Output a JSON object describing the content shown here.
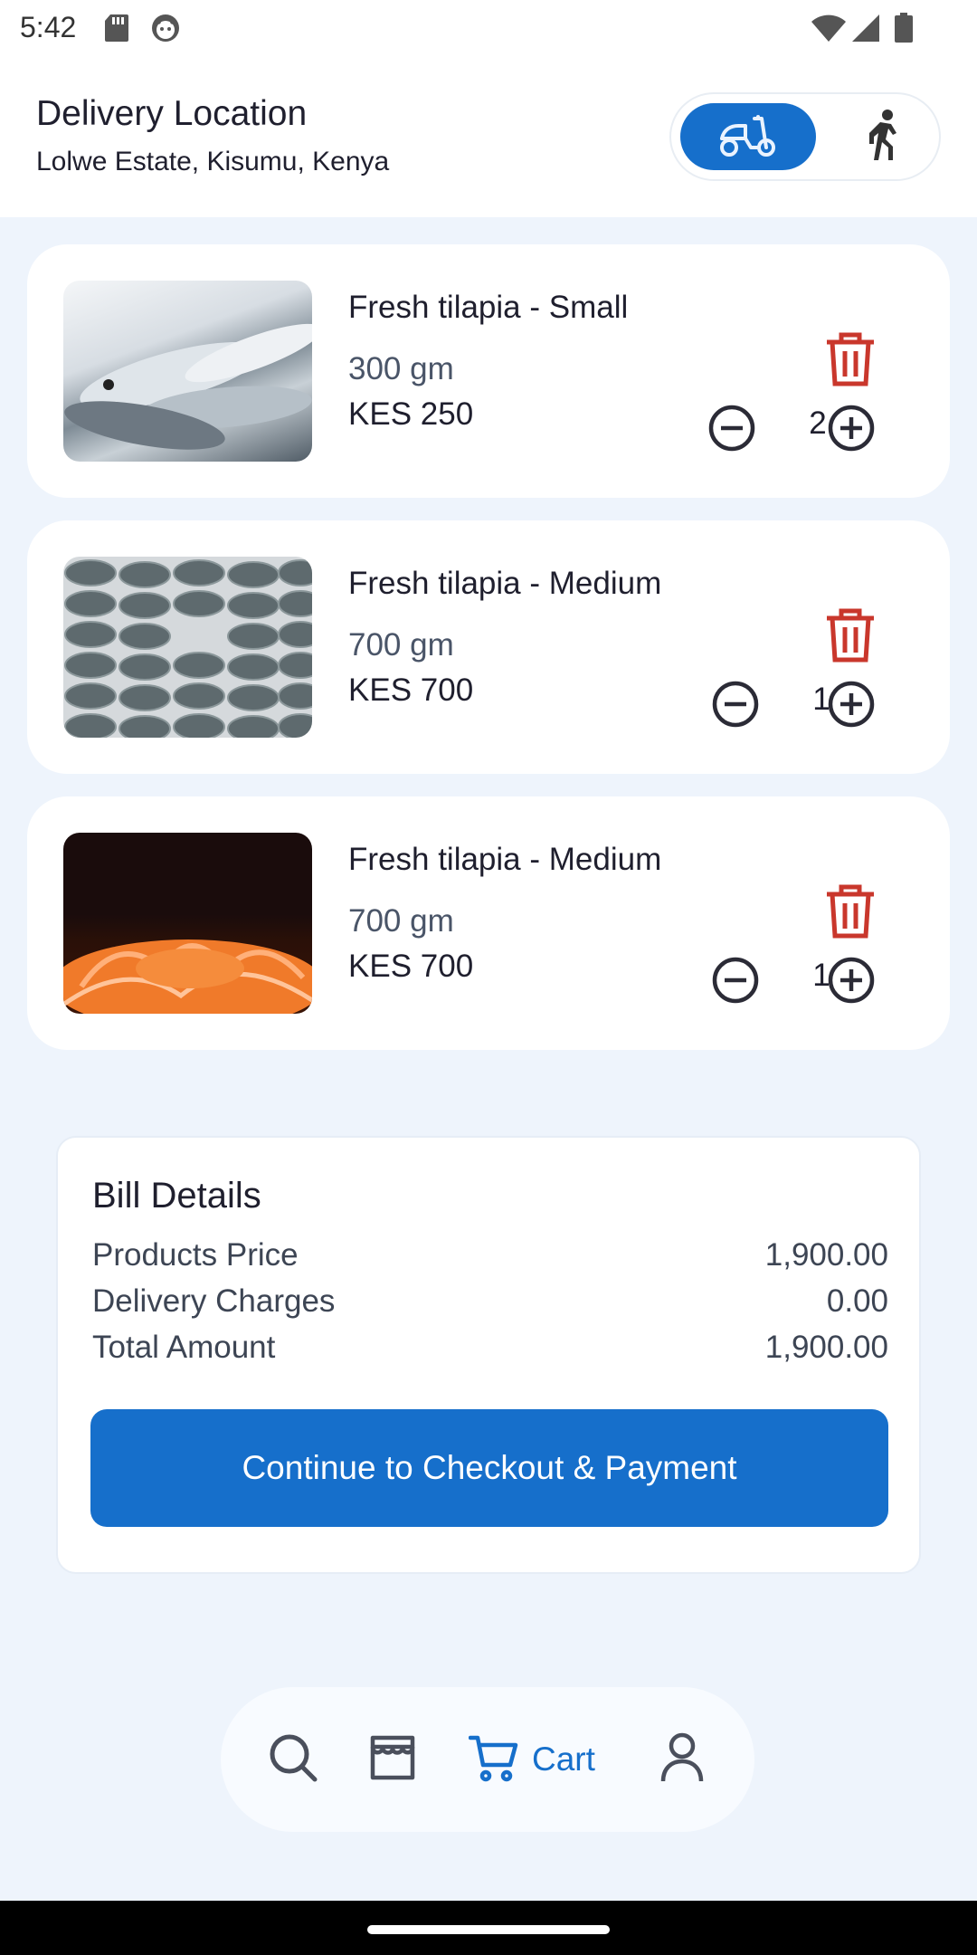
{
  "status": {
    "time": "5:42"
  },
  "header": {
    "title": "Delivery Location",
    "address": "Lolwe Estate, Kisumu, Kenya",
    "modes": [
      "scooter-icon",
      "walking-icon"
    ],
    "selected_mode": "scooter-icon"
  },
  "cart": {
    "items": [
      {
        "name": "Fresh tilapia - Small",
        "weight": "300 gm",
        "price": "KES 250",
        "qty": "2",
        "image": "fish-on-ice-photo"
      },
      {
        "name": "Fresh tilapia - Medium",
        "weight": "700 gm",
        "price": "KES 700",
        "qty": "1",
        "image": "tilapia-rows-photo"
      },
      {
        "name": "Fresh tilapia - Medium",
        "weight": "700 gm",
        "price": "KES 700",
        "qty": "1",
        "image": "salmon-slices-photo"
      }
    ]
  },
  "bill": {
    "title": "Bill Details",
    "rows": [
      {
        "label": "Products Price",
        "value": "1,900.00"
      },
      {
        "label": "Delivery Charges",
        "value": "0.00"
      },
      {
        "label": "Total Amount",
        "value": "1,900.00"
      }
    ],
    "checkout_label": "Continue to Checkout & Payment"
  },
  "nav": {
    "items": [
      "search-icon",
      "store-icon",
      "cart-icon",
      "profile-icon"
    ],
    "active_label": "Cart"
  },
  "colors": {
    "primary": "#166fcb",
    "danger": "#c9372c",
    "background": "#eef4fc"
  }
}
